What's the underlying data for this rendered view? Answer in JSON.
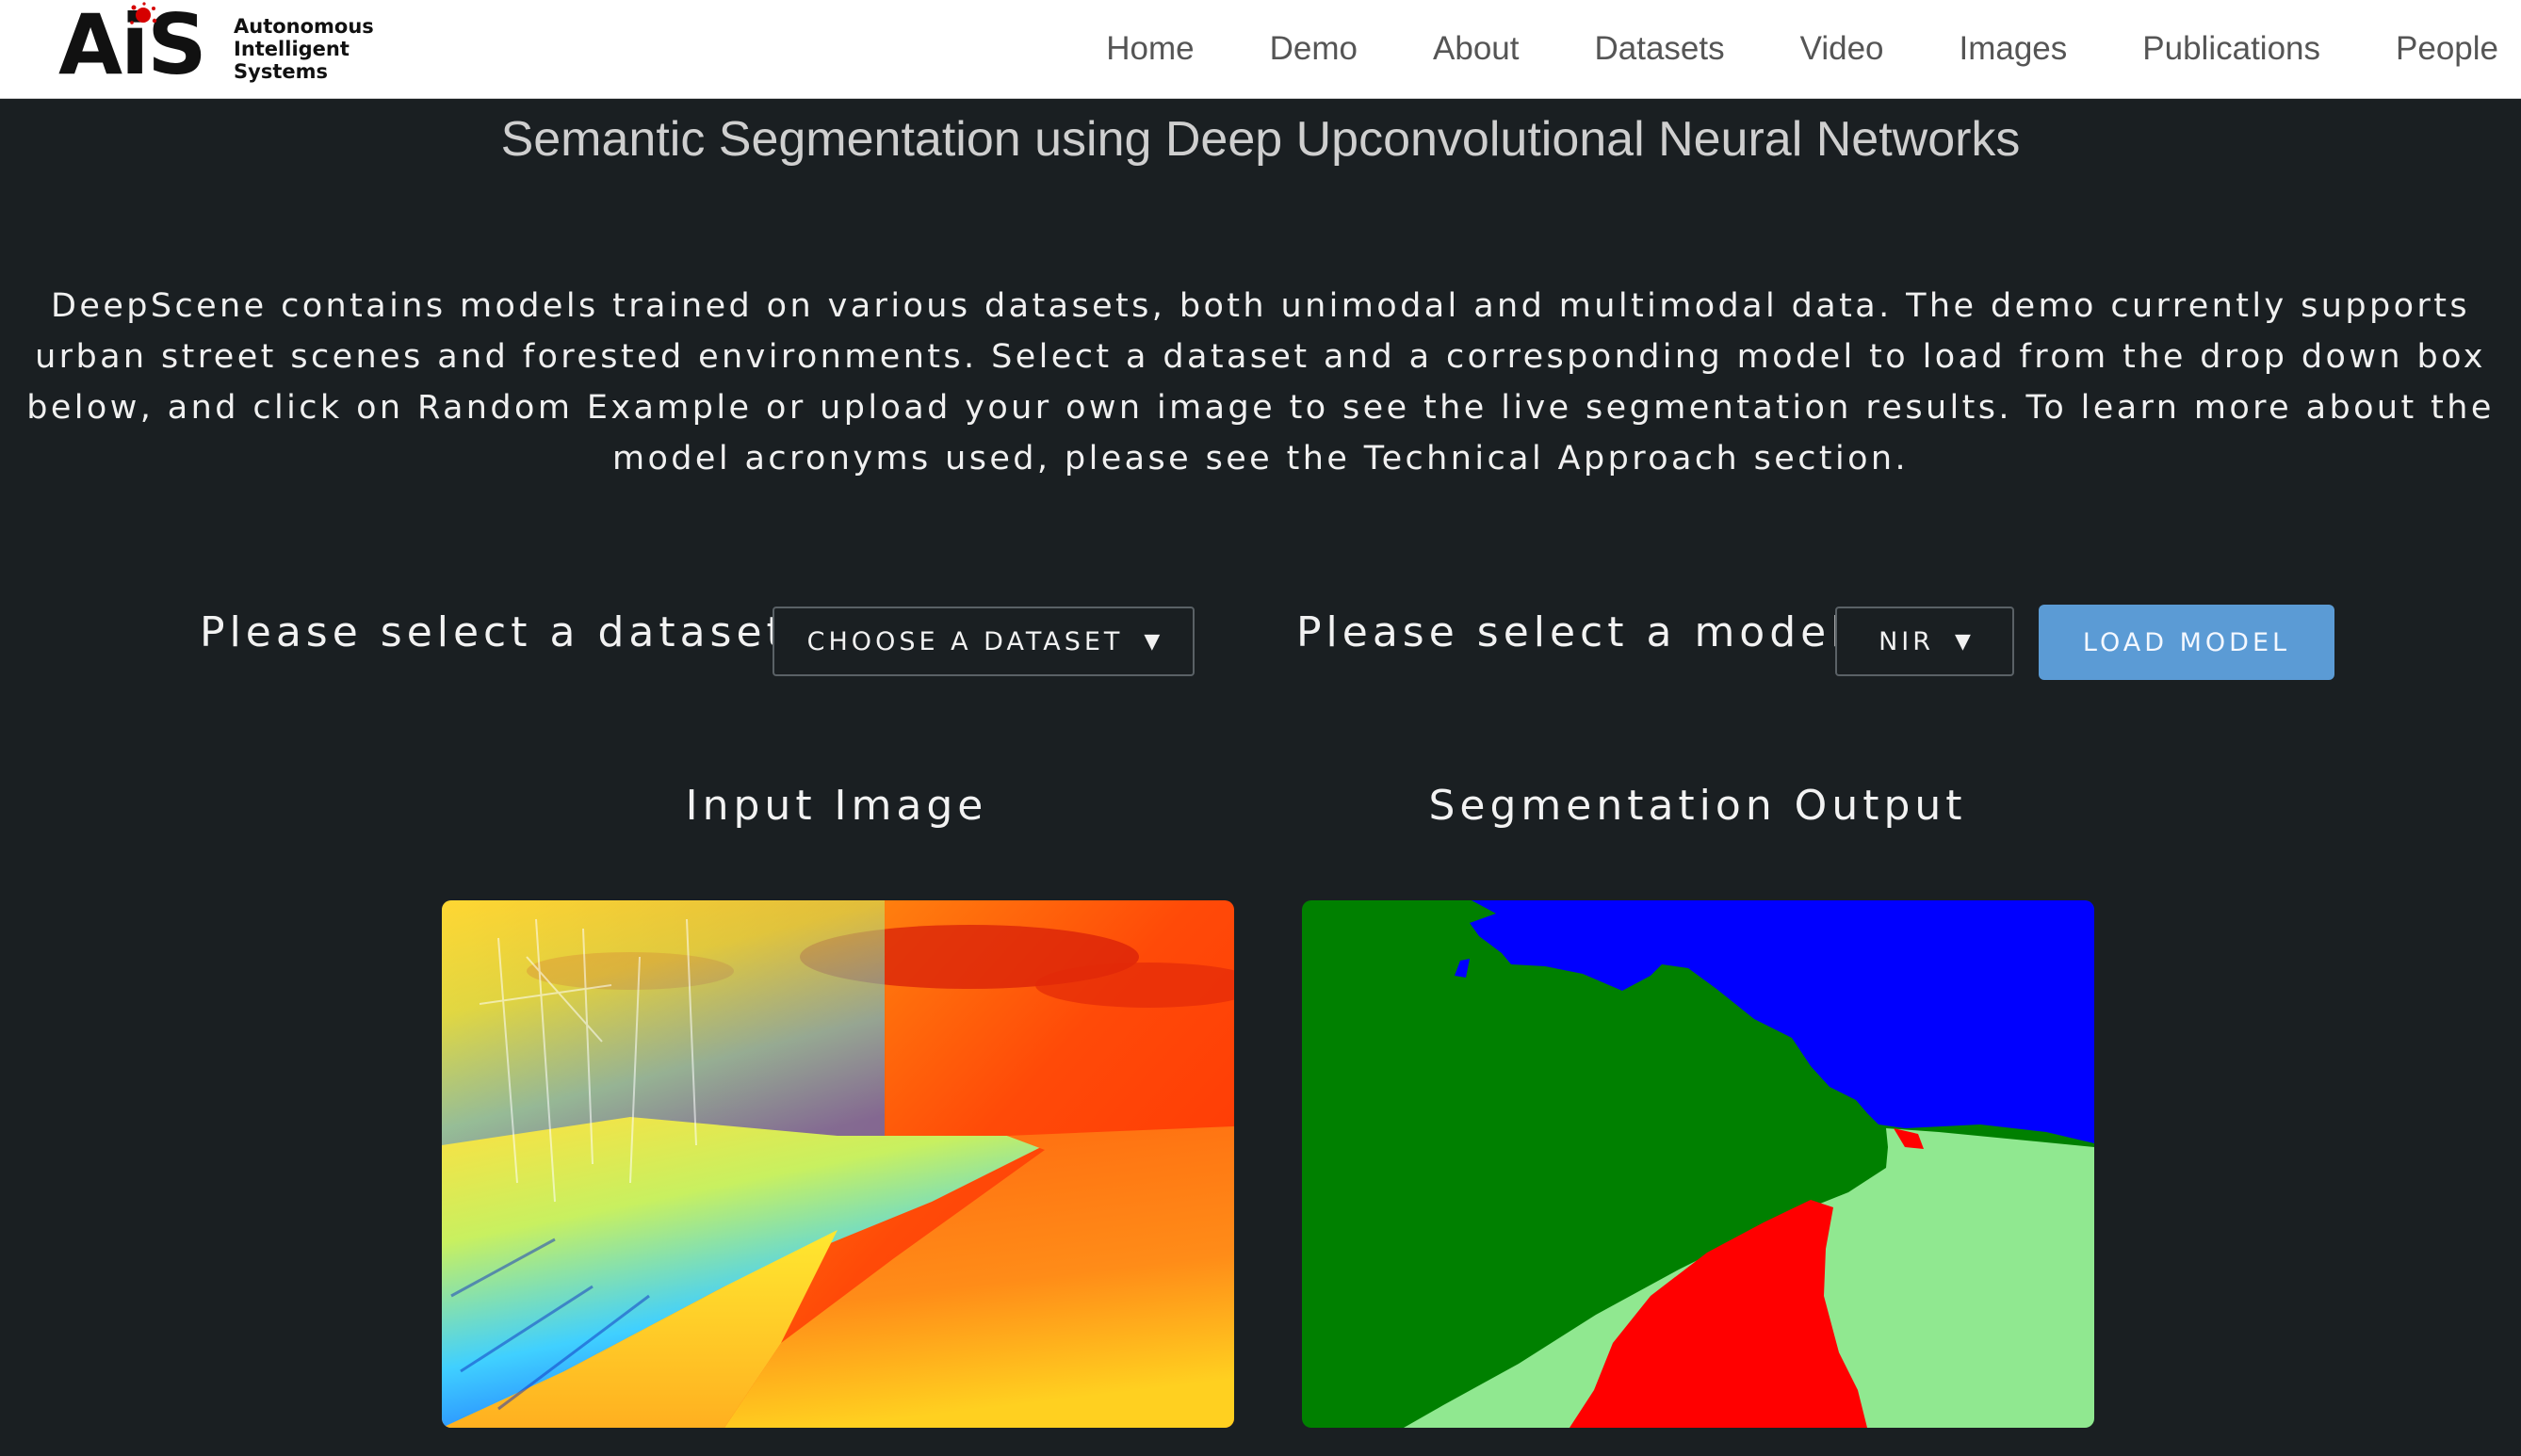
{
  "logo": {
    "mark": "AiS",
    "lines": [
      "Autonomous",
      "Intelligent",
      "Systems"
    ]
  },
  "nav": {
    "items": [
      "Home",
      "Demo",
      "About",
      "Datasets",
      "Video",
      "Images",
      "Publications",
      "People"
    ]
  },
  "page": {
    "title": "Semantic Segmentation using Deep Upconvolutional Neural Networks",
    "intro": "DeepScene contains models trained on various datasets, both unimodal and multimodal data. The demo currently supports urban street scenes and forested environments. Select a dataset and a corresponding model to load from the drop down box below, and click on Random Example or upload your own image to see the live segmentation results. To learn more about the model acronyms used, please see the Technical Approach section."
  },
  "controls": {
    "dataset_label": "Please select a dataset:",
    "dataset_value": "CHOOSE A DATASET",
    "model_label": "Please select a model:",
    "model_value": "NIR",
    "load_button": "LOAD MODEL",
    "caret": "▼"
  },
  "panels": {
    "input_title": "Input Image",
    "output_title": "Segmentation Output"
  },
  "colors": {
    "background": "#1a1f22",
    "accent_button": "#5b9bd5",
    "seg_trail": "#ff0000",
    "seg_grass": "#90e890",
    "seg_vegetation": "#008000",
    "seg_sky": "#0000ff"
  }
}
